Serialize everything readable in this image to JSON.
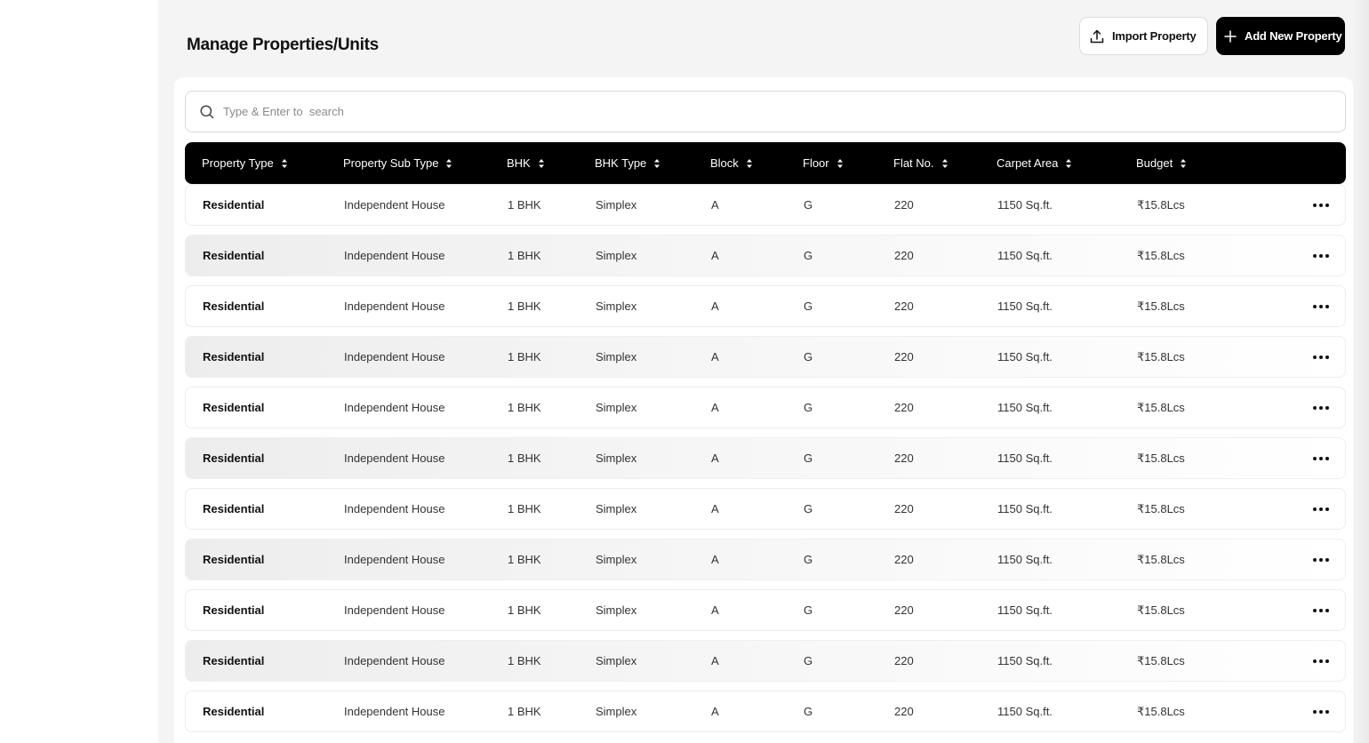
{
  "page": {
    "title": "Manage Properties/Units"
  },
  "toolbar": {
    "import_label": "Import Property",
    "add_label": "Add New Property"
  },
  "search": {
    "placeholder": "Type & Enter to  search"
  },
  "table": {
    "columns": [
      "Property Type",
      "Property Sub Type",
      "BHK",
      "BHK Type",
      "Block",
      "Floor",
      "Flat No.",
      "Carpet Area",
      "Budget"
    ],
    "rows": [
      [
        "Residential",
        "Independent House",
        "1 BHK",
        "Simplex",
        "A",
        "G",
        "220",
        "1150 Sq.ft.",
        "₹15.8Lcs"
      ],
      [
        "Residential",
        "Independent House",
        "1 BHK",
        "Simplex",
        "A",
        "G",
        "220",
        "1150 Sq.ft.",
        "₹15.8Lcs"
      ],
      [
        "Residential",
        "Independent House",
        "1 BHK",
        "Simplex",
        "A",
        "G",
        "220",
        "1150 Sq.ft.",
        "₹15.8Lcs"
      ],
      [
        "Residential",
        "Independent House",
        "1 BHK",
        "Simplex",
        "A",
        "G",
        "220",
        "1150 Sq.ft.",
        "₹15.8Lcs"
      ],
      [
        "Residential",
        "Independent House",
        "1 BHK",
        "Simplex",
        "A",
        "G",
        "220",
        "1150 Sq.ft.",
        "₹15.8Lcs"
      ],
      [
        "Residential",
        "Independent House",
        "1 BHK",
        "Simplex",
        "A",
        "G",
        "220",
        "1150 Sq.ft.",
        "₹15.8Lcs"
      ],
      [
        "Residential",
        "Independent House",
        "1 BHK",
        "Simplex",
        "A",
        "G",
        "220",
        "1150 Sq.ft.",
        "₹15.8Lcs"
      ],
      [
        "Residential",
        "Independent House",
        "1 BHK",
        "Simplex",
        "A",
        "G",
        "220",
        "1150 Sq.ft.",
        "₹15.8Lcs"
      ],
      [
        "Residential",
        "Independent House",
        "1 BHK",
        "Simplex",
        "A",
        "G",
        "220",
        "1150 Sq.ft.",
        "₹15.8Lcs"
      ],
      [
        "Residential",
        "Independent House",
        "1 BHK",
        "Simplex",
        "A",
        "G",
        "220",
        "1150 Sq.ft.",
        "₹15.8Lcs"
      ],
      [
        "Residential",
        "Independent House",
        "1 BHK",
        "Simplex",
        "A",
        "G",
        "220",
        "1150 Sq.ft.",
        "₹15.8Lcs"
      ]
    ],
    "row_action_icon": "more-horizontal-icon",
    "sort_icon": "sort-icon"
  },
  "icons": {
    "import": "upload-icon",
    "add": "plus-icon",
    "search": "search-icon"
  },
  "colors": {
    "header_bg": "#000000",
    "primary_button_bg": "#000000",
    "page_bg": "#f4f4f4",
    "card_bg": "#ffffff"
  }
}
